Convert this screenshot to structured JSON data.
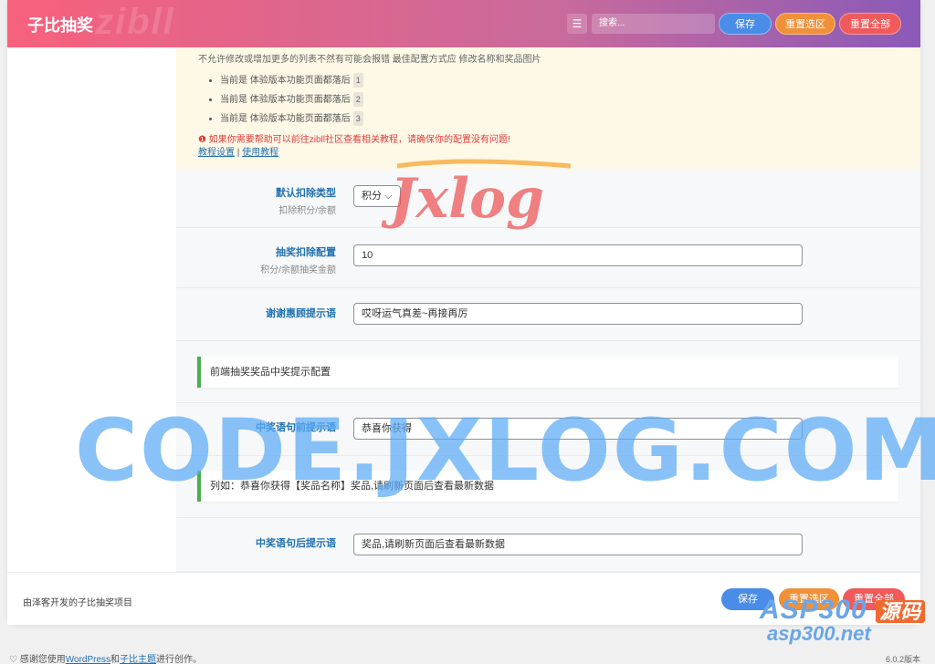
{
  "header": {
    "title": "子比抽奖",
    "watermark": "zibll",
    "search_placeholder": "搜索...",
    "save": "保存",
    "reset_section": "重置选区",
    "reset_all": "重置全部"
  },
  "notice": {
    "line0": "不允许修改或增加更多的列表不然有可能会报错 最佳配置方式应 修改名称和奖品图片",
    "items": [
      {
        "text": "当前是 体验版本功能页面都落后",
        "num": "1"
      },
      {
        "text": "当前是 体验版本功能页面都落后",
        "num": "2"
      },
      {
        "text": "当前是 体验版本功能页面都落后",
        "num": "3"
      }
    ],
    "warning": "❶ 如果你需要帮助可以前往zibll社区查看相关教程，请确保你的配置没有问题!",
    "link1": "教程设置",
    "sep": "|",
    "link2": "使用教程"
  },
  "fields": {
    "deduct_type": {
      "label": "默认扣除类型",
      "sub": "扣除积分/余额",
      "value": "积分"
    },
    "deduct_amount": {
      "label": "抽奖扣除配置",
      "sub": "积分/余额抽奖金额",
      "value": "10"
    },
    "thanks": {
      "label": "谢谢惠顾提示语",
      "value": "哎呀运气真差~再接再厉"
    },
    "prefix": {
      "label": "中奖语句前提示语",
      "value": "恭喜你获得"
    },
    "suffix": {
      "label": "中奖语句后提示语",
      "value": "奖品,请刷新页面后查看最新数据"
    }
  },
  "subheads": {
    "front": "前端抽奖奖品中奖提示配置",
    "example": "列如：恭喜你获得【奖品名称】奖品,请刷新页面后查看最新数据"
  },
  "footer_bar": {
    "text": "由泽客开发的子比抽奖项目",
    "save": "保存",
    "reset_section": "重置选区",
    "reset_all": "重置全部"
  },
  "wp_footer": {
    "pre": "感谢您使用",
    "wp": "WordPress",
    "and": "和",
    "theme": "子比主题",
    "post": "进行创作。",
    "version": "6.0.2版本"
  },
  "watermarks": {
    "code": "CODE.JXLOG.COM",
    "jxlog": "Jxlog",
    "asp": "ASP300",
    "asp_tag": "源码",
    "asp_net": "asp300.net"
  },
  "colors": {
    "accent": "#2271b1",
    "save": "#4a8de8",
    "reset_section": "#f0913a",
    "reset_all": "#f05a5a",
    "green_border": "#4caf50"
  }
}
